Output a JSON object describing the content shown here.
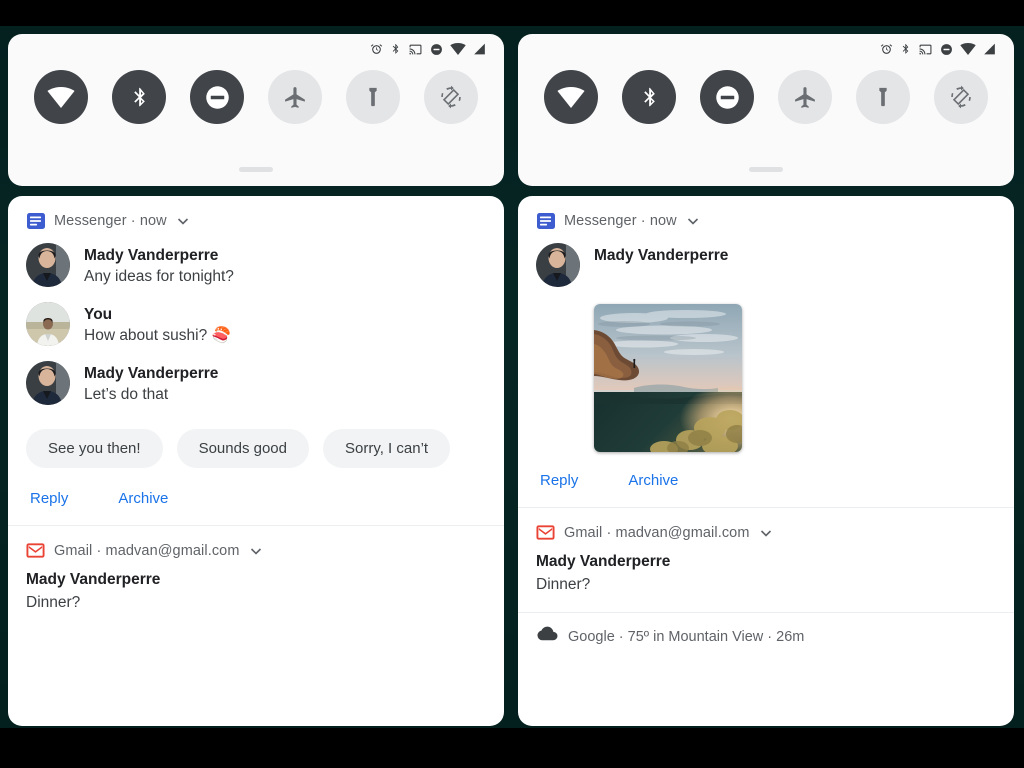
{
  "background": {
    "wallpaper_color": "#04201f",
    "page_color": "#000000"
  },
  "theme": {
    "accent": "#1a73e8",
    "tile_on": "#414549",
    "tile_off": "#e4e5e7",
    "panel": "#ffffff"
  },
  "panels": [
    {
      "id": "left",
      "status_bar": {
        "icons": [
          "alarm-icon",
          "bluetooth-icon",
          "cast-icon",
          "do-not-disturb-icon",
          "wifi-icon",
          "signal-icon"
        ]
      },
      "quick_settings": {
        "tiles": [
          {
            "name": "wifi",
            "icon": "wifi-icon",
            "state": "on"
          },
          {
            "name": "bluetooth",
            "icon": "bluetooth-icon",
            "state": "on"
          },
          {
            "name": "do-not-disturb",
            "icon": "do-not-disturb-icon",
            "state": "on"
          },
          {
            "name": "airplane",
            "icon": "airplane-icon",
            "state": "off"
          },
          {
            "name": "flashlight",
            "icon": "flashlight-icon",
            "state": "off"
          },
          {
            "name": "auto-rotate",
            "icon": "auto-rotate-icon",
            "state": "off"
          }
        ]
      },
      "notifications": [
        {
          "app": "Messenger",
          "app_icon": "messenger-icon",
          "header": "Messenger · now",
          "messages": [
            {
              "sender": "Mady Vanderperre",
              "text": "Any ideas for tonight?",
              "avatar": "avatar-mady"
            },
            {
              "sender": "You",
              "text": "How about sushi? 🍣",
              "avatar": "avatar-you"
            },
            {
              "sender": "Mady Vanderperre",
              "text": "Let’s do that",
              "avatar": "avatar-mady"
            }
          ],
          "smart_replies": [
            "See you then!",
            "Sounds good",
            "Sorry, I can’t"
          ],
          "actions": [
            "Reply",
            "Archive"
          ]
        },
        {
          "app": "Gmail",
          "app_icon": "gmail-icon",
          "header": "Gmail · madvan@gmail.com",
          "title": "Mady Vanderperre",
          "subtitle": "Dinner?"
        }
      ]
    },
    {
      "id": "right",
      "status_bar": {
        "icons": [
          "alarm-icon",
          "bluetooth-icon",
          "cast-icon",
          "do-not-disturb-icon",
          "wifi-icon",
          "signal-icon"
        ]
      },
      "quick_settings": {
        "tiles": [
          {
            "name": "wifi",
            "icon": "wifi-icon",
            "state": "on"
          },
          {
            "name": "bluetooth",
            "icon": "bluetooth-icon",
            "state": "on"
          },
          {
            "name": "do-not-disturb",
            "icon": "do-not-disturb-icon",
            "state": "on"
          },
          {
            "name": "airplane",
            "icon": "airplane-icon",
            "state": "off"
          },
          {
            "name": "flashlight",
            "icon": "flashlight-icon",
            "state": "off"
          },
          {
            "name": "auto-rotate",
            "icon": "auto-rotate-icon",
            "state": "off"
          }
        ]
      },
      "notifications": [
        {
          "app": "Messenger",
          "app_icon": "messenger-icon",
          "header": "Messenger · now",
          "messages": [
            {
              "sender": "Mady Vanderperre",
              "avatar": "avatar-mady",
              "attachment": "landscape-photo"
            }
          ],
          "actions": [
            "Reply",
            "Archive"
          ]
        },
        {
          "app": "Gmail",
          "app_icon": "gmail-icon",
          "header": "Gmail · madvan@gmail.com",
          "title": "Mady Vanderperre",
          "subtitle": "Dinner?"
        },
        {
          "app": "Google",
          "app_icon": "cloud-icon",
          "header": "Google · 75º in Mountain View · 26m"
        }
      ]
    }
  ]
}
